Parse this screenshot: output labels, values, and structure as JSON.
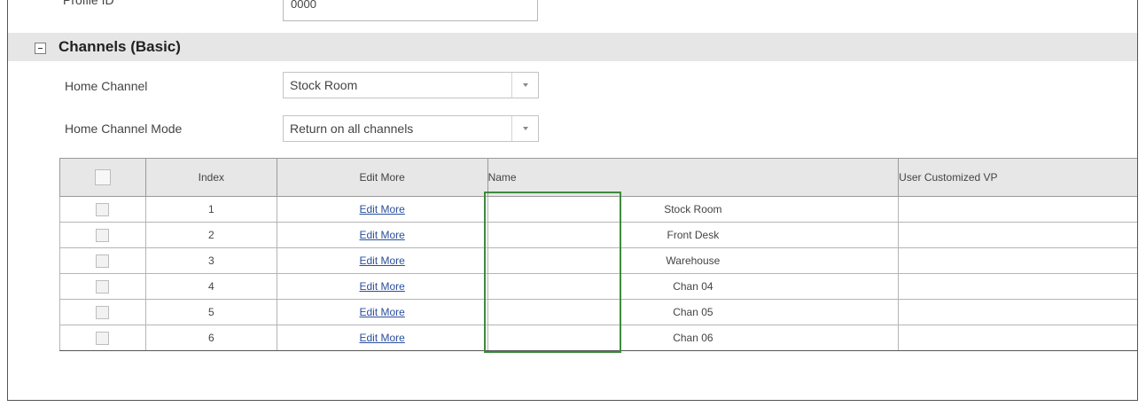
{
  "top": {
    "label": "Profile ID",
    "value": "0000"
  },
  "section": {
    "title": "Channels (Basic)"
  },
  "form": {
    "home_channel": {
      "label": "Home Channel",
      "value": "Stock Room"
    },
    "home_channel_mode": {
      "label": "Home Channel Mode",
      "value": "Return on all channels"
    }
  },
  "table": {
    "headers": {
      "index": "Index",
      "edit_more": "Edit More",
      "name": "Name",
      "user_customized_vp": "User Customized VP"
    },
    "rows": [
      {
        "index": "1",
        "edit_more": "Edit More",
        "name": "Stock Room",
        "user_customized_vp": ""
      },
      {
        "index": "2",
        "edit_more": "Edit More",
        "name": "Front Desk",
        "user_customized_vp": ""
      },
      {
        "index": "3",
        "edit_more": "Edit More",
        "name": "Warehouse",
        "user_customized_vp": ""
      },
      {
        "index": "4",
        "edit_more": "Edit More",
        "name": "Chan 04",
        "user_customized_vp": ""
      },
      {
        "index": "5",
        "edit_more": "Edit More",
        "name": "Chan 05",
        "user_customized_vp": ""
      },
      {
        "index": "6",
        "edit_more": "Edit More",
        "name": "Chan 06",
        "user_customized_vp": ""
      }
    ]
  },
  "colors": {
    "highlight": "#3e8a3e",
    "link": "#2a4f9e",
    "section_bg": "#e6e6e6"
  }
}
